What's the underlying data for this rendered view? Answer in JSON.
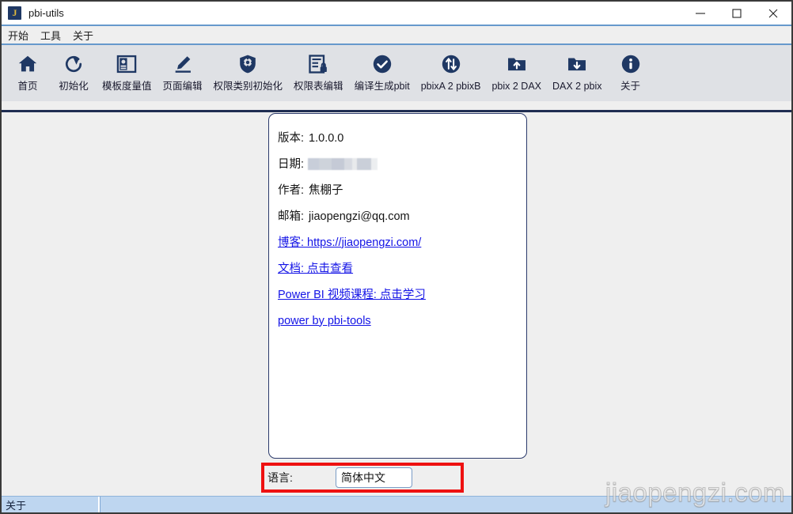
{
  "window": {
    "title": "pbi-utils",
    "app_icon": "app-logo-j-icon",
    "icon_letter": "J",
    "controls": {
      "minimize": "minimize-icon",
      "maximize": "maximize-icon",
      "close": "close-icon"
    }
  },
  "menubar": {
    "items": [
      {
        "label": "开始"
      },
      {
        "label": "工具"
      },
      {
        "label": "关于"
      }
    ]
  },
  "toolbar": {
    "items": [
      {
        "label": "首页",
        "icon": "home-icon"
      },
      {
        "label": "初始化",
        "icon": "refresh-counterclockwise-icon"
      },
      {
        "label": "模板度量值",
        "icon": "table-layout-icon"
      },
      {
        "label": "页面编辑",
        "icon": "pencil-edit-icon"
      },
      {
        "label": "权限类别初始化",
        "icon": "shield-gear-icon"
      },
      {
        "label": "权限表编辑",
        "icon": "document-lock-icon"
      },
      {
        "label": "编译生成pbit",
        "icon": "check-circle-icon"
      },
      {
        "label": "pbixA 2 pbixB",
        "icon": "swap-arrows-circle-icon"
      },
      {
        "label": "pbix 2 DAX",
        "icon": "folder-upload-icon"
      },
      {
        "label": "DAX 2 pbix",
        "icon": "folder-download-icon"
      },
      {
        "label": "关于",
        "icon": "info-circle-icon"
      }
    ]
  },
  "about_card": {
    "version": {
      "label": "版本:",
      "value": "1.0.0.0"
    },
    "date": {
      "label": "日期:",
      "value": "",
      "redacted": true
    },
    "author": {
      "label": "作者:",
      "value": "焦棚子"
    },
    "email": {
      "label": "邮箱:",
      "value": "jiaopengzi@qq.com"
    },
    "blog": {
      "text": "博客: https://jiaopengzi.com/"
    },
    "docs": {
      "text": "文档: 点击查看"
    },
    "course": {
      "text": "Power BI 视频课程: 点击学习"
    },
    "powered_by": {
      "text": "power by pbi-tools"
    }
  },
  "language": {
    "label": "语言:",
    "value": "简体中文"
  },
  "statusbar": {
    "cell1": "关于",
    "cell2": ""
  },
  "watermark": {
    "text": "jiaopengzi.com"
  },
  "colors": {
    "accent": "#1f3864",
    "link": "#1313e6",
    "highlight": "#ee1111",
    "statusbar": "#bed6f0",
    "toolbar": "#dfe1e5",
    "content": "#efefef"
  }
}
